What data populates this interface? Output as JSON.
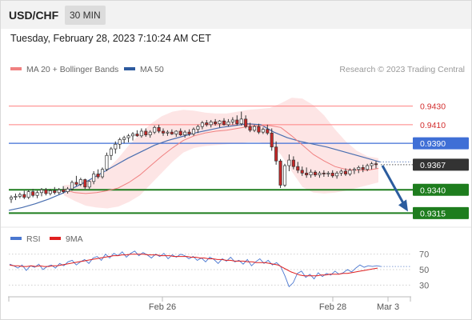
{
  "header": {
    "symbol": "USD/CHF",
    "timeframe": "30 MIN",
    "datetime": "Tuesday, February 28, 2023 7:10:24 AM CET"
  },
  "legend": {
    "items": [
      {
        "label": "MA 20 + Bollinger Bands",
        "color": "#f08080"
      },
      {
        "label": "MA 50",
        "color": "#2d5a9e"
      }
    ],
    "credit": "Research © 2023 Trading Central"
  },
  "colors": {
    "candle_up": "#ffffff",
    "candle_down": "#c62828",
    "bollinger_fill": "#fde0e0",
    "ma20": "#f08080",
    "ma50": "#4a6fb0",
    "support": "#1e7d1e",
    "resistance": "#ff8080",
    "pivot": "#3f6fd6",
    "last": "#333333",
    "arrow": "#2b5c9e",
    "rsi": "#4a77d0",
    "rsi_ma": "#e02020"
  },
  "chart_data": [
    {
      "type": "candlestick",
      "ylim": [
        0.9305,
        0.9458
      ],
      "price_levels": [
        {
          "value": 0.943,
          "label": "0.9430",
          "role": "resistance"
        },
        {
          "value": 0.941,
          "label": "0.9410",
          "role": "resistance"
        },
        {
          "value": 0.939,
          "label": "0.9390",
          "role": "pivot"
        },
        {
          "value": 0.9367,
          "label": "0.9367",
          "role": "last"
        },
        {
          "value": 0.934,
          "label": "0.9340",
          "role": "support"
        },
        {
          "value": 0.9315,
          "label": "0.9315",
          "role": "support"
        }
      ],
      "candles": [
        [
          0.933,
          0.9334,
          0.9326,
          0.9332
        ],
        [
          0.9332,
          0.9336,
          0.9329,
          0.9333
        ],
        [
          0.9333,
          0.9337,
          0.9331,
          0.9335
        ],
        [
          0.9335,
          0.9339,
          0.933,
          0.9332
        ],
        [
          0.9332,
          0.934,
          0.933,
          0.9338
        ],
        [
          0.9338,
          0.9341,
          0.9332,
          0.9334
        ],
        [
          0.9334,
          0.9339,
          0.9331,
          0.9337
        ],
        [
          0.9337,
          0.9342,
          0.9333,
          0.934
        ],
        [
          0.934,
          0.9342,
          0.9334,
          0.9336
        ],
        [
          0.9336,
          0.9341,
          0.9334,
          0.9339
        ],
        [
          0.9339,
          0.9343,
          0.9335,
          0.9337
        ],
        [
          0.9337,
          0.9342,
          0.9335,
          0.934
        ],
        [
          0.934,
          0.9344,
          0.9336,
          0.9338
        ],
        [
          0.9338,
          0.9343,
          0.9336,
          0.9341
        ],
        [
          0.9341,
          0.935,
          0.9339,
          0.9348
        ],
        [
          0.9348,
          0.9355,
          0.9344,
          0.9346
        ],
        [
          0.9346,
          0.9353,
          0.9344,
          0.9351
        ],
        [
          0.9351,
          0.9352,
          0.9341,
          0.9343
        ],
        [
          0.9343,
          0.935,
          0.9341,
          0.9349
        ],
        [
          0.9349,
          0.936,
          0.9346,
          0.9357
        ],
        [
          0.9357,
          0.9362,
          0.9352,
          0.9354
        ],
        [
          0.9354,
          0.9364,
          0.9352,
          0.9362
        ],
        [
          0.9362,
          0.938,
          0.936,
          0.9377
        ],
        [
          0.9377,
          0.9386,
          0.9372,
          0.9384
        ],
        [
          0.9384,
          0.9392,
          0.9379,
          0.9389
        ],
        [
          0.9389,
          0.9396,
          0.9384,
          0.9394
        ],
        [
          0.9394,
          0.9398,
          0.939,
          0.9396
        ],
        [
          0.9396,
          0.94,
          0.9391,
          0.9398
        ],
        [
          0.9398,
          0.9402,
          0.9393,
          0.94
        ],
        [
          0.94,
          0.9404,
          0.9397,
          0.9398
        ],
        [
          0.9398,
          0.9406,
          0.9396,
          0.9403
        ],
        [
          0.9403,
          0.9406,
          0.9397,
          0.9399
        ],
        [
          0.9399,
          0.9404,
          0.9396,
          0.9402
        ],
        [
          0.9402,
          0.9409,
          0.94,
          0.9407
        ],
        [
          0.9407,
          0.941,
          0.9401,
          0.9403
        ],
        [
          0.9403,
          0.9406,
          0.9398,
          0.9401
        ],
        [
          0.9401,
          0.9404,
          0.9398,
          0.9402
        ],
        [
          0.9402,
          0.9405,
          0.9399,
          0.94
        ],
        [
          0.94,
          0.9404,
          0.9397,
          0.9403
        ],
        [
          0.9403,
          0.9406,
          0.9398,
          0.9399
        ],
        [
          0.9399,
          0.9404,
          0.9396,
          0.9402
        ],
        [
          0.9402,
          0.9405,
          0.9398,
          0.94
        ],
        [
          0.94,
          0.9407,
          0.9398,
          0.9405
        ],
        [
          0.9405,
          0.941,
          0.9401,
          0.9408
        ],
        [
          0.9408,
          0.9414,
          0.9405,
          0.9412
        ],
        [
          0.9412,
          0.9415,
          0.9408,
          0.941
        ],
        [
          0.941,
          0.9415,
          0.9407,
          0.9413
        ],
        [
          0.9413,
          0.9416,
          0.9409,
          0.9411
        ],
        [
          0.9411,
          0.9415,
          0.9407,
          0.9414
        ],
        [
          0.9414,
          0.9417,
          0.9409,
          0.941
        ],
        [
          0.941,
          0.9416,
          0.9408,
          0.9413
        ],
        [
          0.9413,
          0.9418,
          0.941,
          0.9415
        ],
        [
          0.9415,
          0.942,
          0.9409,
          0.9411
        ],
        [
          0.9411,
          0.9424,
          0.9409,
          0.9416
        ],
        [
          0.9416,
          0.942,
          0.9406,
          0.9408
        ],
        [
          0.9408,
          0.9412,
          0.9402,
          0.9404
        ],
        [
          0.9404,
          0.941,
          0.9402,
          0.9408
        ],
        [
          0.9408,
          0.9411,
          0.94,
          0.9402
        ],
        [
          0.9402,
          0.9407,
          0.94,
          0.9405
        ],
        [
          0.9405,
          0.941,
          0.9399,
          0.9401
        ],
        [
          0.9401,
          0.9406,
          0.9382,
          0.9386
        ],
        [
          0.9386,
          0.9392,
          0.9367,
          0.9371
        ],
        [
          0.9371,
          0.9373,
          0.9342,
          0.9345
        ],
        [
          0.9345,
          0.9368,
          0.9343,
          0.9366
        ],
        [
          0.9366,
          0.9378,
          0.936,
          0.9372
        ],
        [
          0.9372,
          0.9376,
          0.9362,
          0.9365
        ],
        [
          0.9365,
          0.937,
          0.9358,
          0.9361
        ],
        [
          0.9361,
          0.9365,
          0.9355,
          0.9358
        ],
        [
          0.9358,
          0.9364,
          0.9353,
          0.9356
        ],
        [
          0.9356,
          0.9362,
          0.9353,
          0.9359
        ],
        [
          0.9359,
          0.9361,
          0.9354,
          0.9356
        ],
        [
          0.9356,
          0.936,
          0.9353,
          0.9358
        ],
        [
          0.9358,
          0.9361,
          0.9354,
          0.9357
        ],
        [
          0.9357,
          0.936,
          0.9354,
          0.9358
        ],
        [
          0.9358,
          0.9361,
          0.9353,
          0.9355
        ],
        [
          0.9355,
          0.936,
          0.9352,
          0.9358
        ],
        [
          0.9358,
          0.9362,
          0.9355,
          0.936
        ],
        [
          0.936,
          0.9363,
          0.9355,
          0.9357
        ],
        [
          0.9357,
          0.9363,
          0.9355,
          0.9361
        ],
        [
          0.9361,
          0.9364,
          0.9357,
          0.9362
        ],
        [
          0.9362,
          0.9366,
          0.9358,
          0.9364
        ],
        [
          0.9364,
          0.9367,
          0.9359,
          0.9362
        ],
        [
          0.9362,
          0.9368,
          0.936,
          0.9366
        ],
        [
          0.9366,
          0.937,
          0.9362,
          0.9368
        ],
        [
          0.9368,
          0.9371,
          0.9363,
          0.9367
        ]
      ],
      "ma20": [
        0.934,
        0.9337,
        0.9336,
        0.9337,
        0.9339,
        0.9342,
        0.9348,
        0.9356,
        0.9366,
        0.9376,
        0.9385,
        0.9393,
        0.9398,
        0.9401,
        0.9403,
        0.9404,
        0.9406,
        0.9408,
        0.9409,
        0.9409,
        0.9407,
        0.9398,
        0.9388,
        0.9378,
        0.9371,
        0.9365,
        0.9362,
        0.9361,
        0.9361,
        0.9363
      ],
      "bb_upper": [
        0.9345,
        0.9346,
        0.9349,
        0.9354,
        0.9362,
        0.9374,
        0.9388,
        0.94,
        0.9411,
        0.9419,
        0.9424,
        0.9426,
        0.9425,
        0.9423,
        0.9422,
        0.9422,
        0.9424,
        0.9426,
        0.9427,
        0.9428,
        0.9433,
        0.9439,
        0.9438,
        0.9431,
        0.942,
        0.9405,
        0.9392,
        0.9382,
        0.9376,
        0.9374
      ],
      "bb_lower": [
        0.9334,
        0.9328,
        0.9323,
        0.9321,
        0.932,
        0.9322,
        0.9327,
        0.9334,
        0.9346,
        0.9358,
        0.937,
        0.938,
        0.9385,
        0.9387,
        0.9388,
        0.9389,
        0.939,
        0.9391,
        0.9391,
        0.9389,
        0.9378,
        0.936,
        0.9343,
        0.9337,
        0.9336,
        0.9337,
        0.9339,
        0.9342,
        0.9345,
        0.9348
      ],
      "ma50": [
        0.9318,
        0.9321,
        0.9325,
        0.933,
        0.9336,
        0.9343,
        0.935,
        0.9358,
        0.9366,
        0.9374,
        0.9381,
        0.9388,
        0.9393,
        0.9397,
        0.9401,
        0.9404,
        0.9407,
        0.9409,
        0.9411,
        0.941,
        0.9402,
        0.9396,
        0.9392,
        0.9389,
        0.9386,
        0.9382,
        0.9378,
        0.9374,
        0.937
      ],
      "forecast_arrow": {
        "from": 0.9366,
        "to": 0.9315
      }
    },
    {
      "type": "line",
      "legend": [
        {
          "label": "RSI",
          "color": "#4a77d0"
        },
        {
          "label": "9MA",
          "color": "#e02020"
        }
      ],
      "ylim": [
        20,
        80
      ],
      "y_ticks": [
        70,
        50,
        30
      ],
      "rsi": [
        57,
        55,
        52,
        56,
        49,
        55,
        53,
        57,
        50,
        54,
        56,
        52,
        58,
        55,
        60,
        62,
        56,
        60,
        63,
        58,
        65,
        67,
        62,
        70,
        65,
        71,
        68,
        73,
        66,
        71,
        74,
        68,
        72,
        69,
        65,
        70,
        67,
        71,
        64,
        69,
        66,
        70,
        68,
        64,
        67,
        62,
        65,
        60,
        66,
        63,
        58,
        64,
        61,
        66,
        60,
        62,
        57,
        63,
        55,
        60,
        64,
        58,
        62,
        56,
        59,
        54,
        42,
        28,
        33,
        45,
        48,
        40,
        44,
        38,
        46,
        41,
        45,
        43,
        48,
        44,
        46,
        50,
        47,
        52,
        56,
        53,
        55,
        54,
        55,
        54
      ],
      "rsi_ma": [
        56,
        55,
        55,
        54,
        54,
        55,
        54,
        55,
        54,
        54,
        55,
        55,
        56,
        57,
        58,
        59,
        60,
        61,
        62,
        63,
        64,
        65,
        66,
        67,
        68,
        68,
        69,
        69,
        70,
        70,
        70,
        70,
        69,
        69,
        69,
        68,
        68,
        68,
        67,
        67,
        67,
        67,
        66,
        66,
        65,
        65,
        64,
        64,
        63,
        63,
        62,
        62,
        61,
        61,
        61,
        60,
        60,
        59,
        59,
        59,
        58,
        57,
        56,
        53,
        50,
        47,
        45,
        43,
        42,
        42,
        42,
        42,
        43,
        43,
        44,
        44,
        44,
        45,
        45,
        46,
        47,
        48,
        49,
        50,
        51,
        52
      ],
      "x_ticks": [
        "Feb 26",
        "Feb 28",
        "Mar 3"
      ]
    }
  ]
}
